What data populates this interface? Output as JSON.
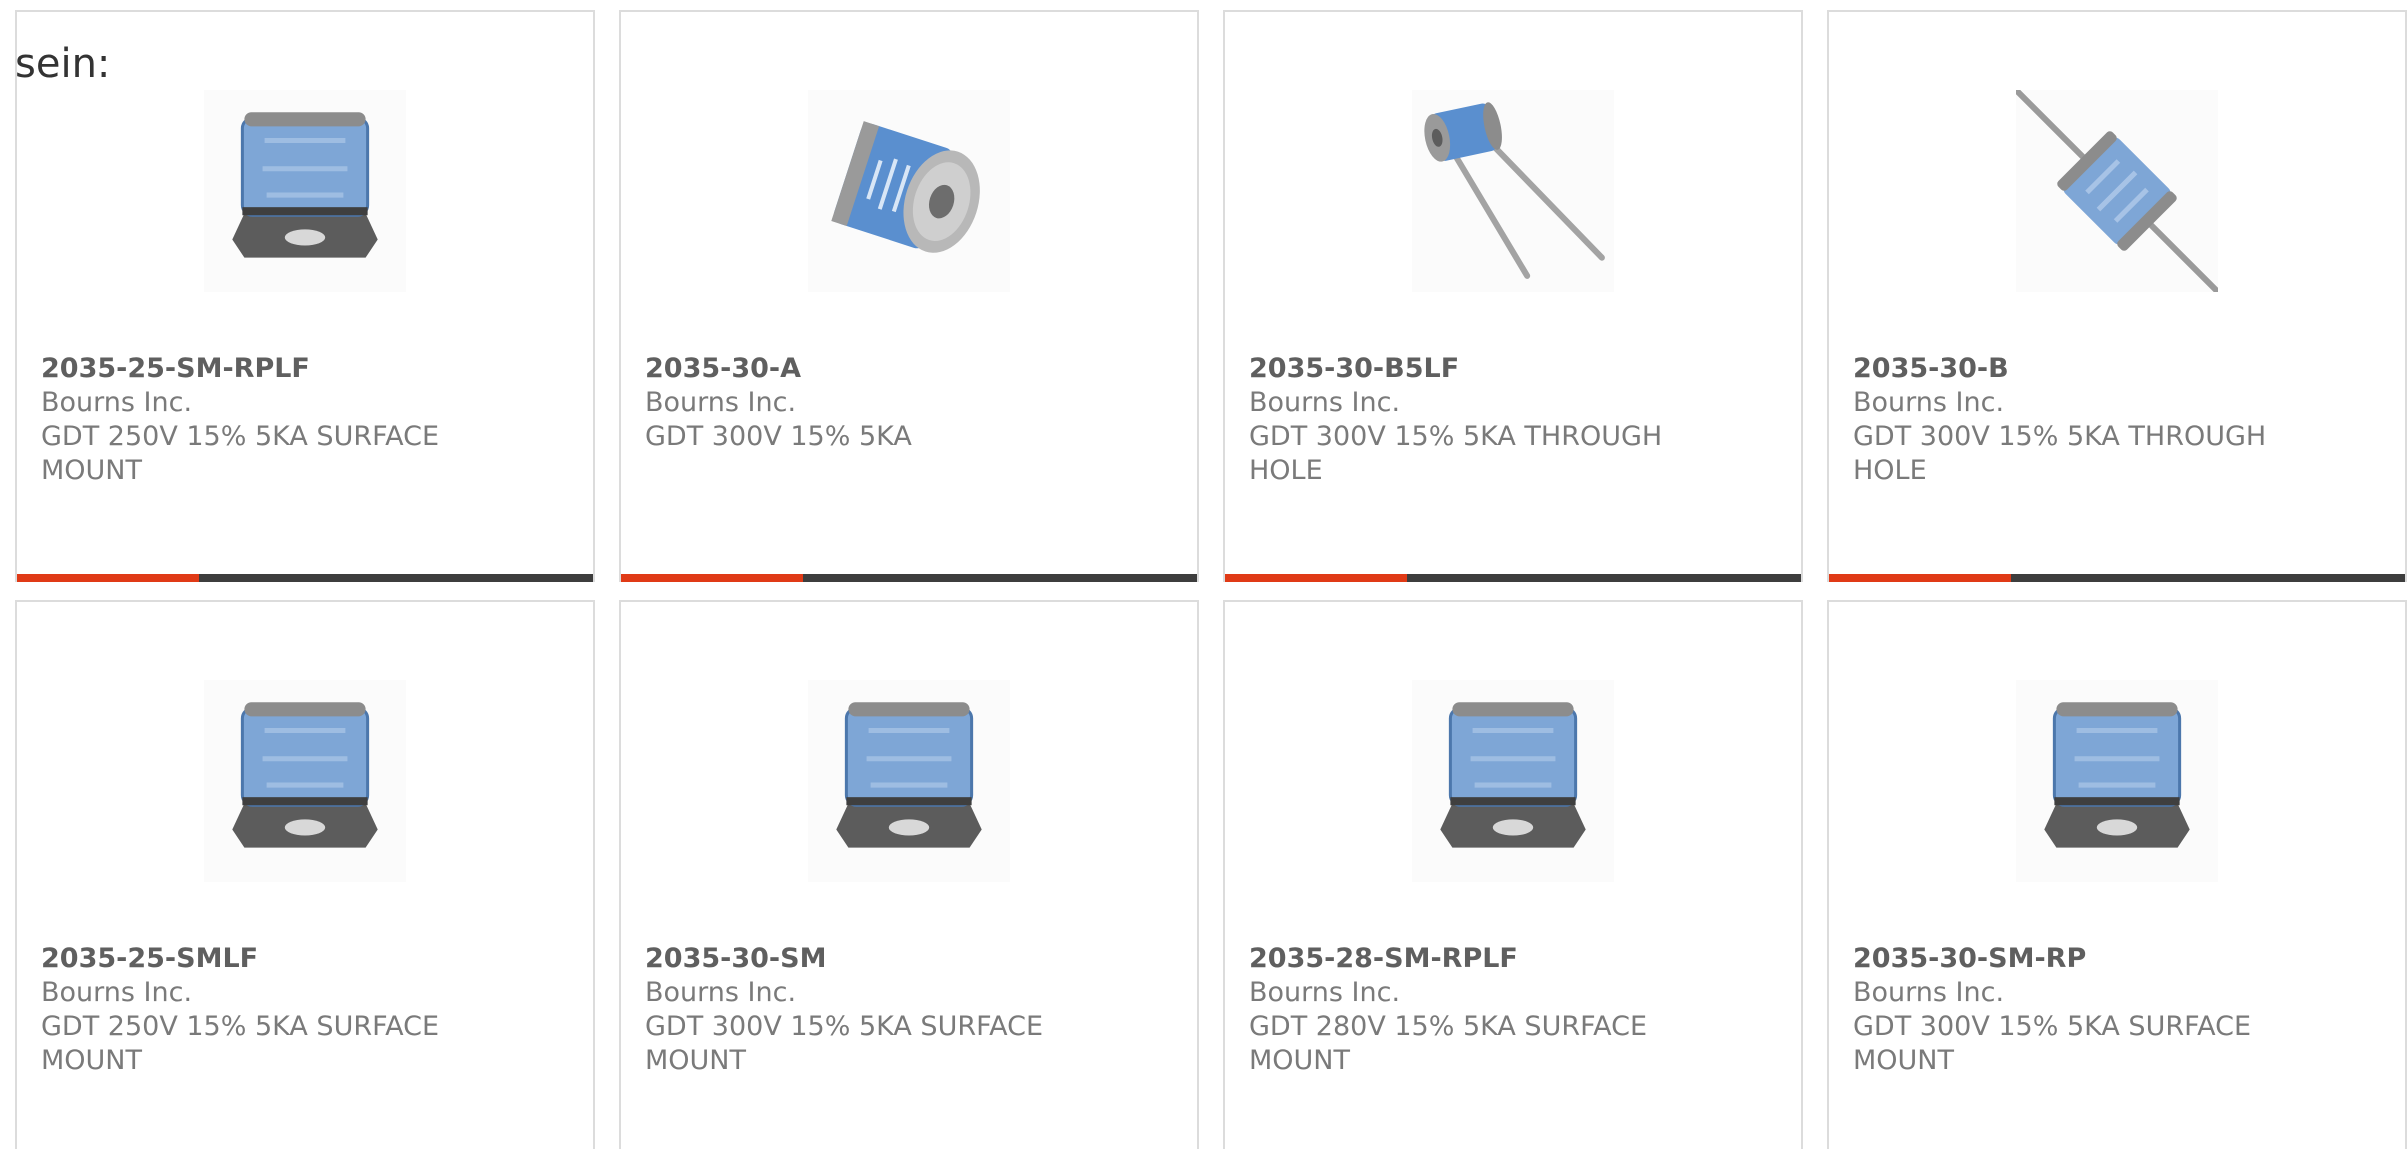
{
  "intro": {
    "text": "sein:"
  },
  "colors": {
    "accent": "#e03a16",
    "bar": "#3d3d3d",
    "border": "#dcdcdc",
    "title": "#5f5f5f",
    "text": "#7a7a7a",
    "component_blue": "#7ea6d6",
    "component_metal": "#6b6b6b"
  },
  "products": [
    {
      "part_number": "2035-25-SM-RPLF",
      "manufacturer": "Bourns Inc.",
      "description_1": "GDT 250V 15% 5KA SURFACE",
      "description_2": "MOUNT",
      "image_icon": "smd-gas-discharge-tube-image",
      "show_bar": true
    },
    {
      "part_number": "2035-30-A",
      "manufacturer": "Bourns Inc.",
      "description_1": "GDT 300V 15% 5KA",
      "description_2": "",
      "image_icon": "cylindrical-gas-discharge-tube-image",
      "show_bar": true
    },
    {
      "part_number": "2035-30-B5LF",
      "manufacturer": "Bourns Inc.",
      "description_1": "GDT 300V 15% 5KA THROUGH",
      "description_2": "HOLE",
      "image_icon": "radial-lead-gas-discharge-tube-image",
      "show_bar": true
    },
    {
      "part_number": "2035-30-B",
      "manufacturer": "Bourns Inc.",
      "description_1": "GDT 300V 15% 5KA THROUGH",
      "description_2": "HOLE",
      "image_icon": "axial-lead-gas-discharge-tube-image",
      "show_bar": true
    },
    {
      "part_number": "2035-25-SMLF",
      "manufacturer": "Bourns Inc.",
      "description_1": "GDT 250V 15% 5KA SURFACE",
      "description_2": "MOUNT",
      "image_icon": "smd-gas-discharge-tube-image",
      "show_bar": false
    },
    {
      "part_number": "2035-30-SM",
      "manufacturer": "Bourns Inc.",
      "description_1": "GDT 300V 15% 5KA SURFACE",
      "description_2": "MOUNT",
      "image_icon": "smd-gas-discharge-tube-image",
      "show_bar": false
    },
    {
      "part_number": "2035-28-SM-RPLF",
      "manufacturer": "Bourns Inc.",
      "description_1": "GDT 280V 15% 5KA SURFACE",
      "description_2": "MOUNT",
      "image_icon": "smd-gas-discharge-tube-image",
      "show_bar": false
    },
    {
      "part_number": "2035-30-SM-RP",
      "manufacturer": "Bourns Inc.",
      "description_1": "GDT 300V 15% 5KA SURFACE",
      "description_2": "MOUNT",
      "image_icon": "smd-gas-discharge-tube-image",
      "show_bar": false
    }
  ]
}
